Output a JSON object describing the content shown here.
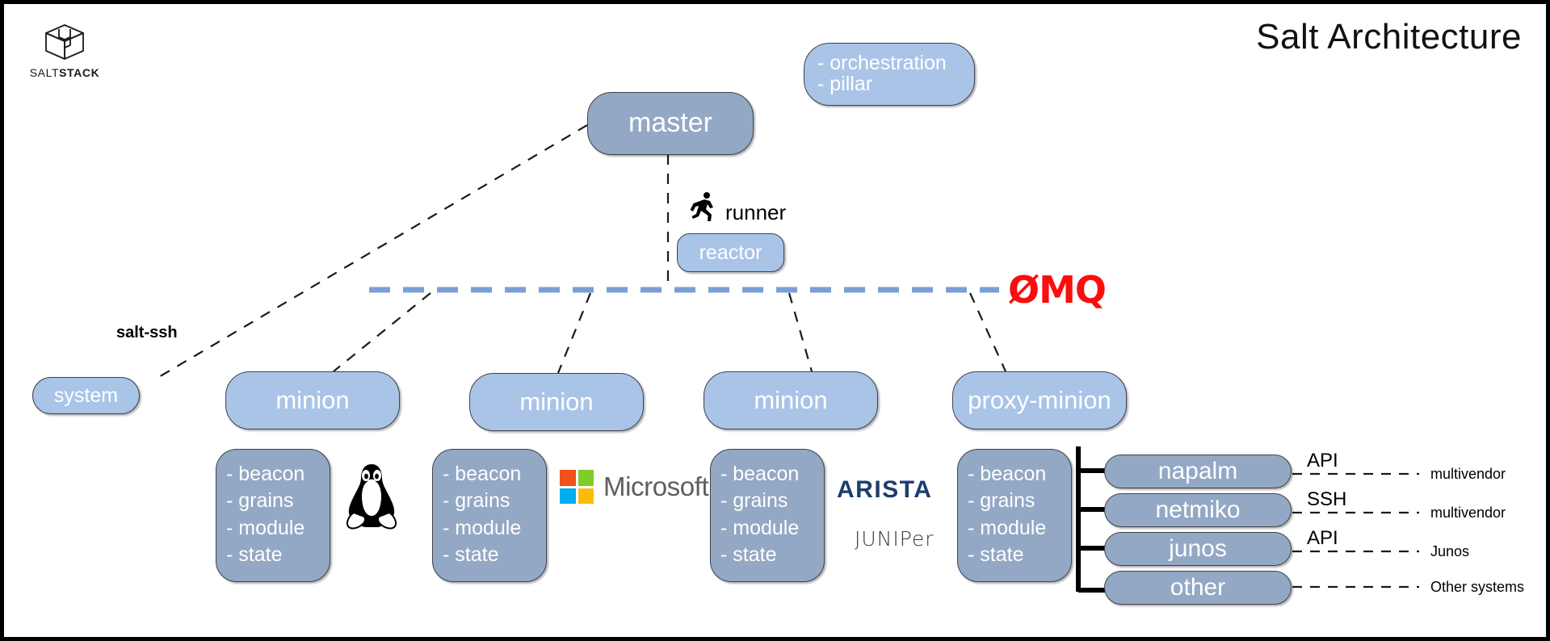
{
  "title": "Salt Architecture",
  "logo": {
    "name": "saltstack-logo",
    "word_light": "SALT",
    "word_bold": "STACK"
  },
  "nodes": {
    "master": {
      "label": "master",
      "style": "dark"
    },
    "orchestration": {
      "lines": [
        "- orchestration",
        "- pillar"
      ],
      "style": "light"
    },
    "reactor": {
      "label": "reactor",
      "style": "light"
    },
    "system": {
      "label": "system",
      "style": "light"
    },
    "minion1": {
      "label": "minion",
      "style": "light"
    },
    "minion2": {
      "label": "minion",
      "style": "light"
    },
    "minion3": {
      "label": "minion",
      "style": "light"
    },
    "proxy_minion": {
      "label": "proxy-minion",
      "style": "light"
    }
  },
  "capability_items": [
    "- beacon",
    "- grains",
    "- module",
    "- state"
  ],
  "labels": {
    "runner": "runner",
    "salt_ssh": "salt-ssh",
    "zeromq": "ØMQ"
  },
  "vendors": {
    "linux": "tux-penguin-logo",
    "microsoft": "Microsoft",
    "arista": "ARISTA",
    "juniper": "JUNIPer"
  },
  "proxy_modules": [
    {
      "name": "napalm",
      "protocol": "API",
      "target": "multivendor"
    },
    {
      "name": "netmiko",
      "protocol": "SSH",
      "target": "multivendor"
    },
    {
      "name": "junos",
      "protocol": "API",
      "target": "Junos"
    },
    {
      "name": "other",
      "protocol": "",
      "target": "Other systems"
    }
  ],
  "colors": {
    "dark_node": "#93a8c4",
    "light_node": "#aac4e8",
    "zeromq_red": "#fc0d0d",
    "bus_blue": "#7a9fd4",
    "border": "#41414a"
  }
}
